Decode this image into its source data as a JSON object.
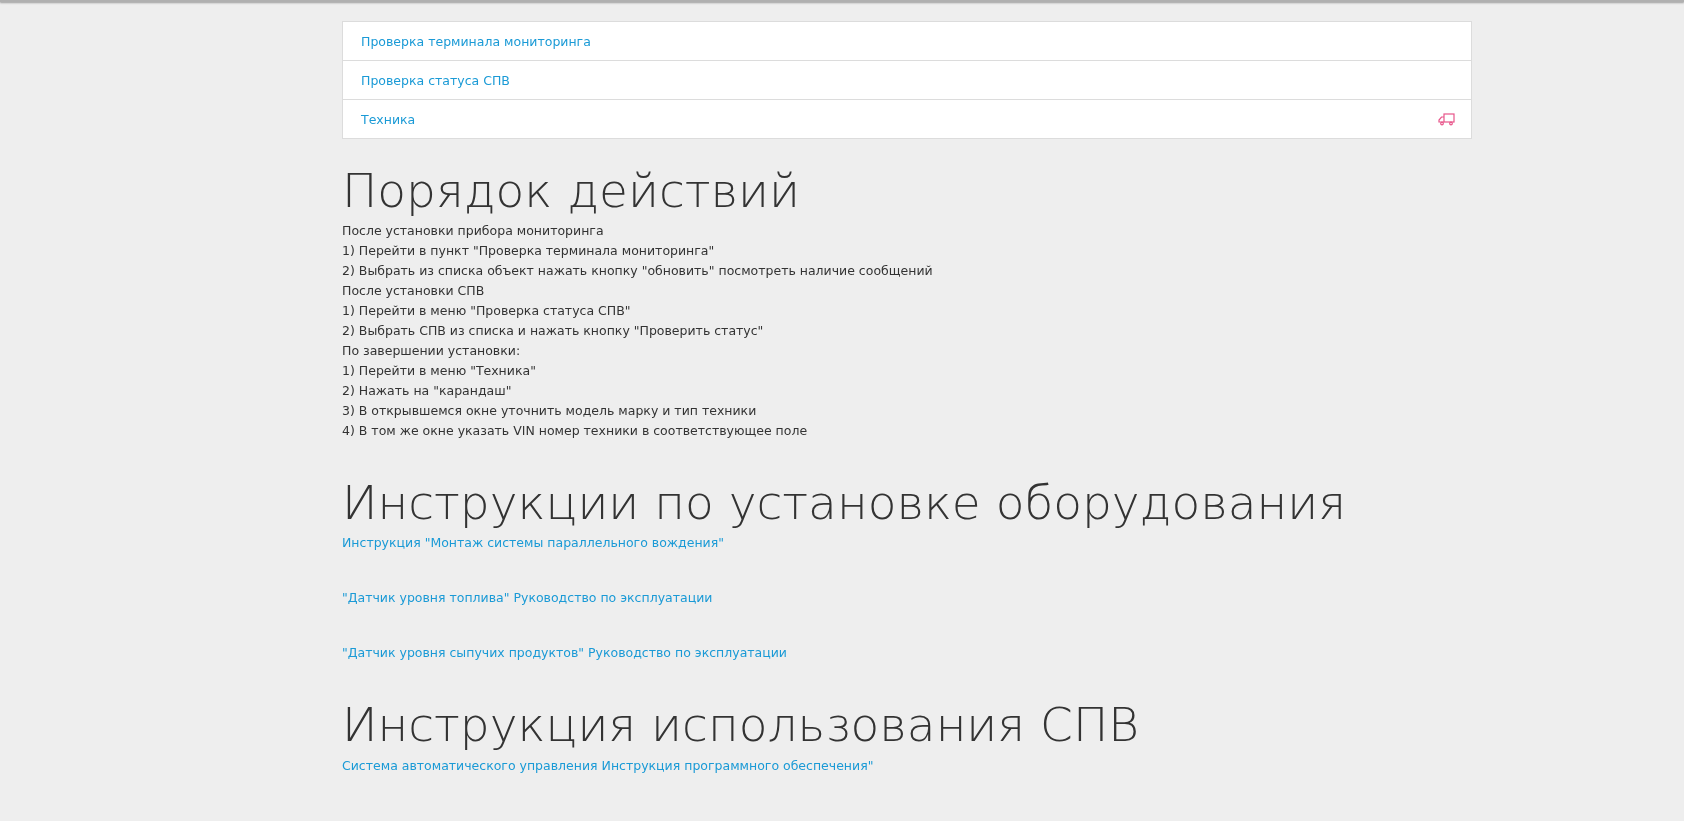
{
  "nav_items": [
    {
      "label": "Проверка терминала мониторинга",
      "kind": "plain"
    },
    {
      "label": "Проверка статуса СПВ",
      "kind": "plain"
    },
    {
      "label": "Техника",
      "kind": "truck"
    }
  ],
  "sections": [
    {
      "title": "Порядок действий",
      "kind": "steps",
      "lines": [
        "После установки прибора мониторинга",
        "1) Перейти в пункт \"Проверка терминала мониторинга\"",
        "2) Выбрать из списка объект нажать кнопку \"обновить\" посмотреть наличие сообщений",
        "После установки СПВ",
        "1) Перейти в меню \"Проверка статуса СПВ\"",
        "2) Выбрать СПВ из списка и нажать кнопку \"Проверить статус\"",
        "По завершении установки:",
        "1) Перейти в меню \"Техника\"",
        "2) Нажать на \"карандаш\"",
        "3) В открывшемся окне уточнить модель марку и тип техники",
        "4) В том же окне указать VIN номер техники в соответствующее поле"
      ]
    },
    {
      "title": "Инструкции по установке оборудования",
      "kind": "links",
      "lines": [
        "Инструкция \"Монтаж системы параллельного вождения\"",
        "\"Датчик уровня топлива\" Руководство по эксплуатации",
        "\"Датчик уровня сыпучих продуктов\" Руководство по эксплуатации"
      ]
    },
    {
      "title": "Инструкция использования СПВ",
      "kind": "links",
      "lines": [
        "Система автоматического управления Инструкция программного обеспечения\""
      ]
    }
  ]
}
